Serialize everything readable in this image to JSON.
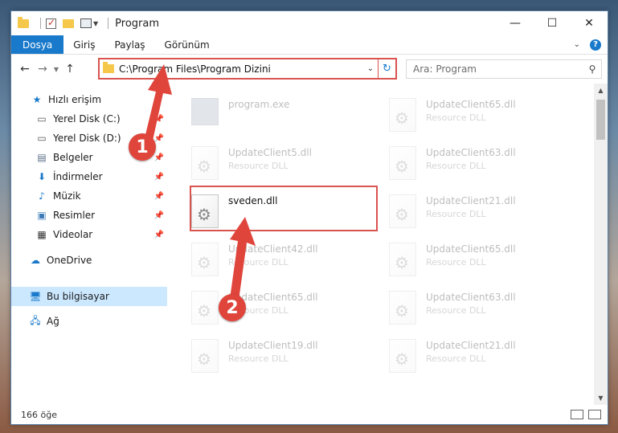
{
  "window": {
    "title": "Program",
    "minimize": "—",
    "maximize": "☐",
    "close": "✕"
  },
  "ribbon": {
    "tabs": [
      "Dosya",
      "Giriş",
      "Paylaş",
      "Görünüm"
    ],
    "help": "?"
  },
  "address": {
    "path": "C:\\Program Files\\Program Dizini",
    "search_placeholder": "Ara: Program"
  },
  "sidebar": {
    "items": [
      {
        "label": "Hızlı erişim",
        "icon": "star-icon"
      },
      {
        "label": "Yerel Disk (C:)",
        "icon": "drive-icon"
      },
      {
        "label": "Yerel Disk (D:)",
        "icon": "drive-icon"
      },
      {
        "label": "Belgeler",
        "icon": "documents-icon"
      },
      {
        "label": "İndirmeler",
        "icon": "download-icon"
      },
      {
        "label": "Müzik",
        "icon": "music-icon"
      },
      {
        "label": "Resimler",
        "icon": "pictures-icon"
      },
      {
        "label": "Videolar",
        "icon": "videos-icon"
      },
      {
        "label": "OneDrive",
        "icon": "cloud-icon"
      },
      {
        "label": "Bu bilgisayar",
        "icon": "computer-icon"
      },
      {
        "label": "Ağ",
        "icon": "network-icon"
      }
    ]
  },
  "files": [
    {
      "name": "program.exe",
      "desc": ""
    },
    {
      "name": "UpdateClient65.dll",
      "desc": "Resource DLL"
    },
    {
      "name": "UpdateClient5.dll",
      "desc": "Resource DLL"
    },
    {
      "name": "UpdateClient63.dll",
      "desc": "Resource DLL"
    },
    {
      "name": "sveden.dll",
      "desc": ""
    },
    {
      "name": "UpdateClient21.dll",
      "desc": "Resource DLL"
    },
    {
      "name": "UpdateClient42.dll",
      "desc": "Resource DLL"
    },
    {
      "name": "UpdateClient65.dll",
      "desc": "Resource DLL"
    },
    {
      "name": "UpdateClient65.dll",
      "desc": "Resource DLL"
    },
    {
      "name": "UpdateClient63.dll",
      "desc": "Resource DLL"
    },
    {
      "name": "UpdateClient19.dll",
      "desc": "Resource DLL"
    },
    {
      "name": "UpdateClient21.dll",
      "desc": "Resource DLL"
    }
  ],
  "status": {
    "count": "166 öğe"
  },
  "annotations": {
    "step1": "1",
    "step2": "2",
    "color": "#e0453c"
  }
}
